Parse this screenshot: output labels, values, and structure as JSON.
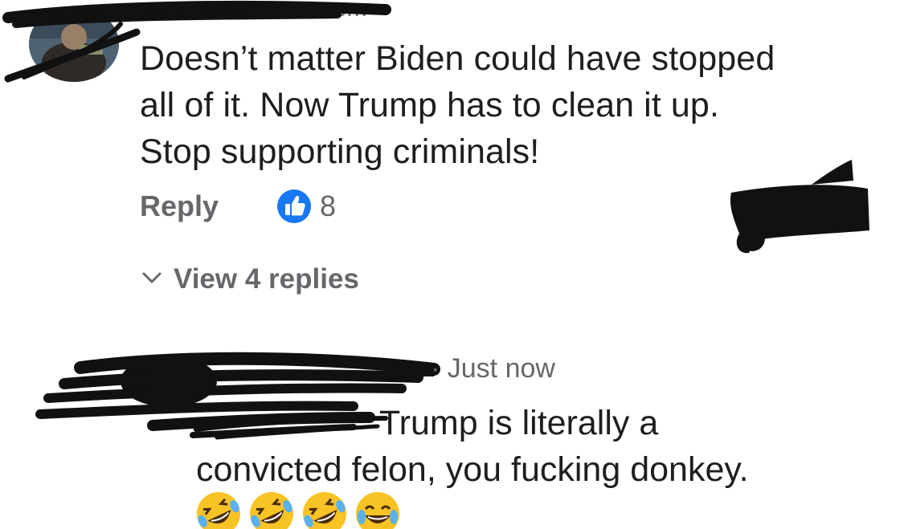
{
  "comment": {
    "author_partial": "com",
    "text_lines": [
      "Doesn’t matter Biden could have stopped",
      "all of it. Now Trump has to clean it up.",
      "Stop supporting criminals!"
    ],
    "reply_label": "Reply",
    "like_count": "8",
    "view_replies_label": "View 4 replies"
  },
  "reply": {
    "timestamp": "· Just now",
    "text_line1": "Trump is literally a",
    "text_line2": "convicted felon, you fucking donkey.",
    "emojis": [
      "rolling-on-floor-laughing",
      "rolling-on-floor-laughing",
      "rolling-on-floor-laughing",
      "tears-of-joy"
    ]
  },
  "colors": {
    "text": "#1c1e21",
    "secondary": "#65676b",
    "like_blue": "#1877f2"
  }
}
